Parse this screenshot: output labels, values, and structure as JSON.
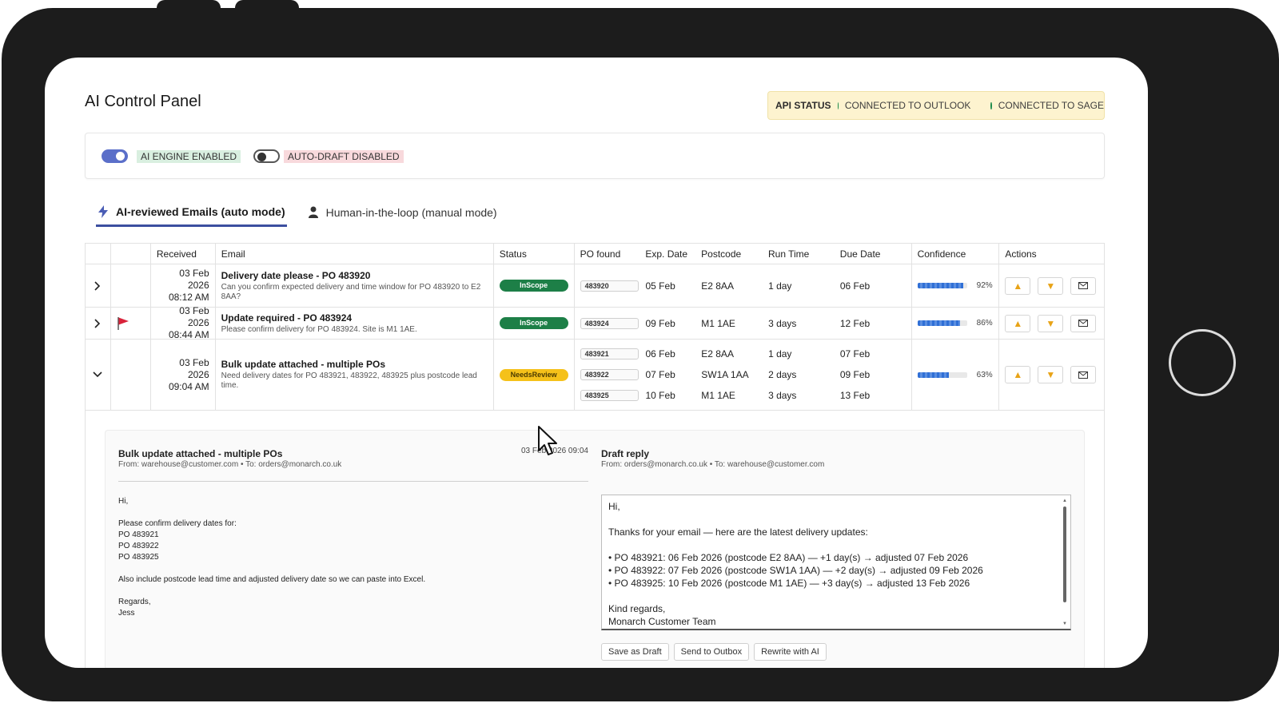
{
  "app": {
    "title": "AI Control Panel"
  },
  "api_status": {
    "label": "API STATUS",
    "outlook": "CONNECTED TO OUTLOOK",
    "sage": "CONNECTED TO SAGE",
    "dot_color": "#1a8a4a"
  },
  "toggles": {
    "ai_engine": {
      "label": "AI ENGINE ENABLED",
      "on": true
    },
    "auto_draft": {
      "label": "AUTO-DRAFT DISABLED",
      "on": false
    }
  },
  "tabs": [
    {
      "label": "AI-reviewed Emails (auto mode)",
      "icon": "lightning-icon",
      "active": true
    },
    {
      "label": "Human-in-the-loop (manual mode)",
      "icon": "person-icon",
      "active": false
    }
  ],
  "table": {
    "headers": {
      "received": "Received",
      "email": "Email",
      "status": "Status",
      "po": "PO found",
      "exp": "Exp. Date",
      "postcode": "Postcode",
      "runtime": "Run Time",
      "due": "Due Date",
      "confidence": "Confidence",
      "actions": "Actions"
    },
    "rows": [
      {
        "date": "03 Feb 2026",
        "time": "08:12 AM",
        "subject": "Delivery date please - PO 483920",
        "snippet": "Can you confirm expected delivery and time window for PO 483920 to E2 8AA?",
        "status": "InScope",
        "pos": [
          {
            "po": "483920",
            "exp": "05 Feb",
            "postcode": "E2 8AA",
            "runtime": "1 day",
            "due": "06 Feb"
          }
        ],
        "confidence": 0.92,
        "confidence_label": "92%",
        "flagged": false,
        "expanded": false
      },
      {
        "date": "03 Feb 2026",
        "time": "08:44 AM",
        "subject": "Update required - PO 483924",
        "snippet": "Please confirm delivery for PO 483924. Site is M1 1AE.",
        "status": "InScope",
        "pos": [
          {
            "po": "483924",
            "exp": "09 Feb",
            "postcode": "M1 1AE",
            "runtime": "3 days",
            "due": "12 Feb"
          }
        ],
        "confidence": 0.86,
        "confidence_label": "86%",
        "flagged": true,
        "expanded": false
      },
      {
        "date": "03 Feb 2026",
        "time": "09:04 AM",
        "subject": "Bulk update attached - multiple POs",
        "snippet": "Need delivery dates for PO 483921, 483922, 483925 plus postcode lead time.",
        "status": "NeedsReview",
        "pos": [
          {
            "po": "483921",
            "exp": "06 Feb",
            "postcode": "E2 8AA",
            "runtime": "1 day",
            "due": "07 Feb"
          },
          {
            "po": "483922",
            "exp": "07 Feb",
            "postcode": "SW1A 1AA",
            "runtime": "2 days",
            "due": "09 Feb"
          },
          {
            "po": "483925",
            "exp": "10 Feb",
            "postcode": "M1 1AE",
            "runtime": "3 days",
            "due": "13 Feb"
          }
        ],
        "confidence": 0.63,
        "confidence_label": "63%",
        "flagged": false,
        "expanded": true
      }
    ]
  },
  "detail": {
    "subject": "Bulk update attached - multiple POs",
    "date": "03 Feb 2026 09:04",
    "from": "From: warehouse@customer.com • To: orders@monarch.co.uk",
    "body": "Hi,\n\nPlease confirm delivery dates for:\nPO 483921\nPO 483922\nPO 483925\n\nAlso include postcode lead time and adjusted delivery date so we can paste into Excel.\n\nRegards,\nJess",
    "draft_title": "Draft reply",
    "draft_from": "From: orders@monarch.co.uk • To: warehouse@customer.com",
    "draft_body": "Hi,\n\nThanks for your email — here are the latest delivery updates:\n\n• PO 483921: 06 Feb 2026 (postcode E2 8AA) — +1 day(s) → adjusted 07 Feb 2026\n• PO 483922: 07 Feb 2026 (postcode SW1A 1AA) — +2 day(s) → adjusted 09 Feb 2026\n• PO 483925: 10 Feb 2026 (postcode M1 1AE) — +3 day(s) → adjusted 13 Feb 2026\n\nKind regards,\nMonarch Customer Team",
    "buttons": [
      "Save as Draft",
      "Send to Outbox",
      "Rewrite with AI"
    ]
  }
}
